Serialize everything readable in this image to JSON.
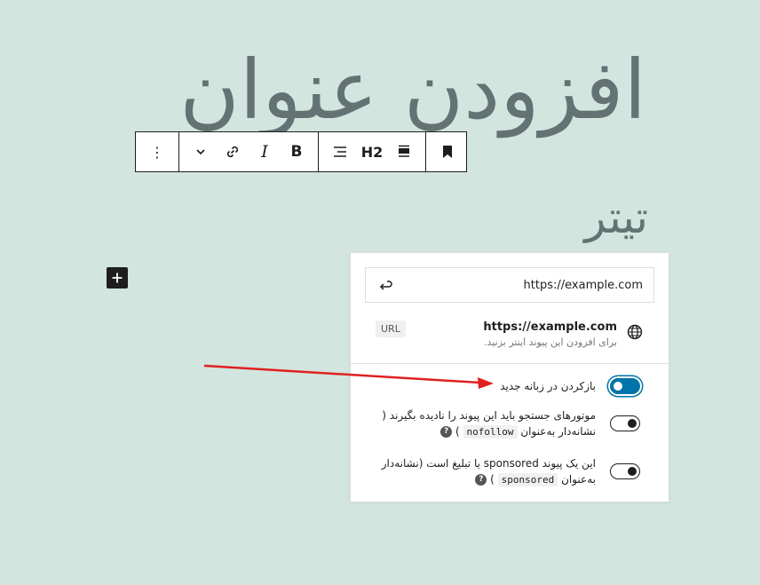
{
  "heading": {
    "title": "افزودن عنوان",
    "subtitle": "تیتر"
  },
  "toolbar": {
    "more_label": "⋮",
    "chevron_label": "⌄",
    "italic_label": "I",
    "bold_label": "B",
    "heading_level_label": "H2"
  },
  "link_popover": {
    "url_value": "https://example.com",
    "suggestion": {
      "title": "https://example.com",
      "description": "برای افزودن این پیوند اینتر بزنید.",
      "badge": "URL"
    },
    "settings": [
      {
        "label": "بازکردن در زبانه جدید",
        "checked": true
      },
      {
        "label_prefix": "موتورهای جستجو باید این پیوند را نادیده بگیرند ( نشانه‌دار به‌عنوان",
        "code": "nofollow",
        "label_suffix": ")",
        "checked": false
      },
      {
        "label_prefix": "این یک پیوند sponsored یا تبلیغ است (نشانه‌دار به‌عنوان",
        "code": "sponsored",
        "label_suffix": ")",
        "checked": false
      }
    ]
  },
  "colors": {
    "background": "#d2e5df",
    "accent": "#0073aa",
    "arrow": "#e02020"
  }
}
